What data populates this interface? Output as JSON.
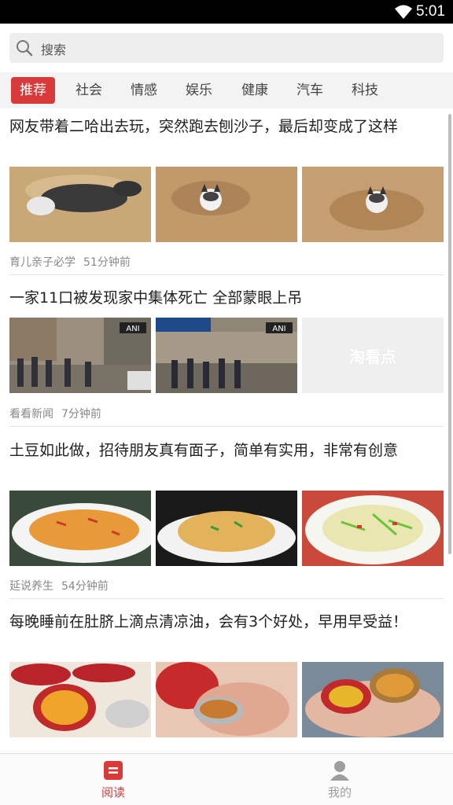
{
  "status_bar": {
    "time": "5:01",
    "wifi_icon": "wifi-icon"
  },
  "search": {
    "placeholder": "搜索",
    "icon": "search-icon"
  },
  "tabs": [
    {
      "label": "推荐",
      "active": true
    },
    {
      "label": "社会",
      "active": false
    },
    {
      "label": "情感",
      "active": false
    },
    {
      "label": "娱乐",
      "active": false
    },
    {
      "label": "健康",
      "active": false
    },
    {
      "label": "汽车",
      "active": false
    },
    {
      "label": "科技",
      "active": false
    }
  ],
  "articles": [
    {
      "title": "网友带着二哈出去玩，突然跑去刨沙子，最后却变成了这样",
      "source": "育儿亲子必学",
      "time": "51分钟前",
      "images": [
        "husky-lying-photo",
        "husky-in-sand-photo",
        "husky-buried-photo"
      ]
    },
    {
      "title": "一家11口被发现家中集体死亡 全部蒙眼上吊",
      "source": "看看新闻",
      "time": "7分钟前",
      "images": [
        "street-crowd-photo",
        "street-crowd-photo-2",
        "placeholder"
      ],
      "image_badge": "ANI",
      "placeholder_text": "淘看点"
    },
    {
      "title": "土豆如此做，招待朋友真有面子，简单有实用，非常有创意",
      "source": "延说养生",
      "time": "54分钟前",
      "images": [
        "potato-dish-photo",
        "potato-dish-photo-2",
        "potato-dish-photo-3"
      ]
    },
    {
      "title": "每晚睡前在肚脐上滴点清凉油，会有3个好处，早用早受益！",
      "source": "",
      "time": "",
      "images": [
        "balm-tins-photo",
        "balm-finger-photo",
        "balm-hand-photo"
      ]
    }
  ],
  "bottom_nav": [
    {
      "label": "阅读",
      "icon": "read-icon",
      "active": true,
      "color": "#d83a3a"
    },
    {
      "label": "我的",
      "icon": "profile-icon",
      "active": false,
      "color": "#9e9e9e"
    }
  ],
  "colors": {
    "accent": "#d83a3a",
    "tab_bar_bg": "#f3f3f3",
    "meta_text": "#888888"
  }
}
